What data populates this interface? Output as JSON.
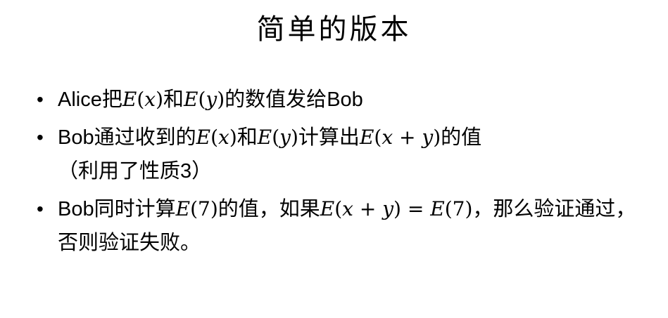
{
  "slide": {
    "title": "简单的版本",
    "bullets": [
      {
        "symbol": "•",
        "t1": "Alice",
        "t2": "把",
        "m1_E": "E",
        "m1_open": "(",
        "m1_x": "x",
        "m1_close": ")",
        "t3": "和",
        "m2_E": "E",
        "m2_open": "(",
        "m2_y": "y",
        "m2_close": ")",
        "t4": "的数值发给",
        "t5": "Bob"
      },
      {
        "symbol": "•",
        "t1": "Bob",
        "t2": "通过收到的",
        "m1_E": "E",
        "m1_open": "(",
        "m1_x": "x",
        "m1_close": ")",
        "t3": "和",
        "m2_E": "E",
        "m2_open": "(",
        "m2_y": "y",
        "m2_close": ")",
        "t4": "计算出",
        "m3_E": "E",
        "m3_open": "(",
        "m3_x": "x",
        "m3_plus": " + ",
        "m3_y": "y",
        "m3_close": ")",
        "t5": "的值",
        "t6": "（利用了性质",
        "t7": "3",
        "t8": "）"
      },
      {
        "symbol": "•",
        "t1": "Bob",
        "t2": "同时计算",
        "m1_E": "E",
        "m1_arg": "(7)",
        "t3": "的值，如果",
        "m2_E": "E",
        "m2_open": "(",
        "m2_x": "x",
        "m2_plus": " + ",
        "m2_y": "y",
        "m2_close": ")",
        "m2_eq": " = ",
        "m2_E2": "E",
        "m2_arg2": "(7)",
        "t4": "，那么验证通过，否则验证失败。"
      }
    ]
  }
}
